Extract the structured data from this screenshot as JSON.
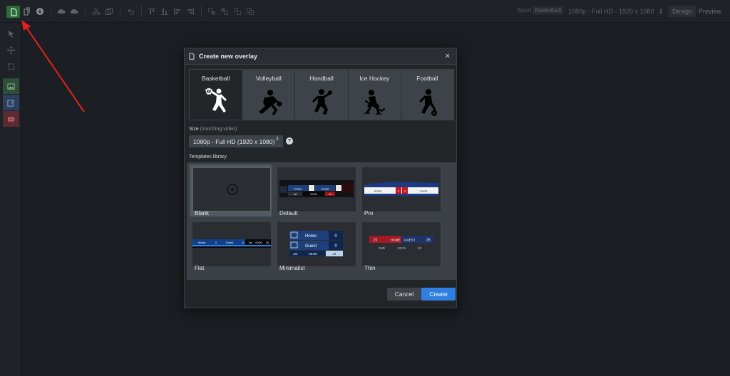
{
  "toolbar": {
    "sport_label": "Sport",
    "sport_value": "Basketball",
    "resolution": "1080p - Full HD - 1920 x 1080",
    "resolution_caret": "⇕",
    "design_label": "Design",
    "preview_label": "Preview"
  },
  "dialog": {
    "title": "Create new overlay",
    "close_label": "×",
    "sports": [
      {
        "label": "Basketball",
        "icon": "basketball-player-icon"
      },
      {
        "label": "Volleyball",
        "icon": "volleyball-player-icon"
      },
      {
        "label": "Handball",
        "icon": "handball-player-icon"
      },
      {
        "label": "Ice Hockey",
        "icon": "ice-hockey-player-icon"
      },
      {
        "label": "Football",
        "icon": "football-player-icon"
      }
    ],
    "size_label": "Size",
    "size_hint": "(matching video)",
    "size_value": "1080p - Full HD (1920 x 1080)",
    "size_caret": "⇕",
    "help_label": "?",
    "templates_label": "Templates library",
    "templates": [
      {
        "name": "Blank"
      },
      {
        "name": "Default"
      },
      {
        "name": "Pro"
      },
      {
        "name": "Flat"
      },
      {
        "name": "Minimalist"
      },
      {
        "name": "Thin"
      }
    ],
    "thumb_text": {
      "default_home": "Home",
      "default_guest": "Guest",
      "default_period": "1st",
      "default_clock": "00:00",
      "default_shot": "24",
      "pro_home": "Home",
      "pro_score_home": "0",
      "pro_score_guest": "0",
      "pro_guest": "Guest",
      "flat_home": "Home",
      "flat_home_score": "0",
      "flat_guest": "Guest",
      "flat_guest_score": "0",
      "flat_period": "1st",
      "flat_clock": "00:00",
      "flat_shot": "24",
      "min_home": "Home",
      "min_home_score": "0",
      "min_guest": "Guest",
      "min_guest_score": "0",
      "min_period": "1st",
      "min_clock": "00:00",
      "min_shot": "24",
      "thin_home_score": "21",
      "thin_home": "HOME",
      "thin_guest": "GUEST",
      "thin_guest_score": "25",
      "thin_period": "2ND",
      "thin_clock": "03:31",
      "thin_shot": "20"
    },
    "cancel_label": "Cancel",
    "create_label": "Create"
  },
  "colors": {
    "accent": "#2e7fe0",
    "new_button": "#2d6b3b",
    "annotation_arrow": "#e0221e"
  }
}
